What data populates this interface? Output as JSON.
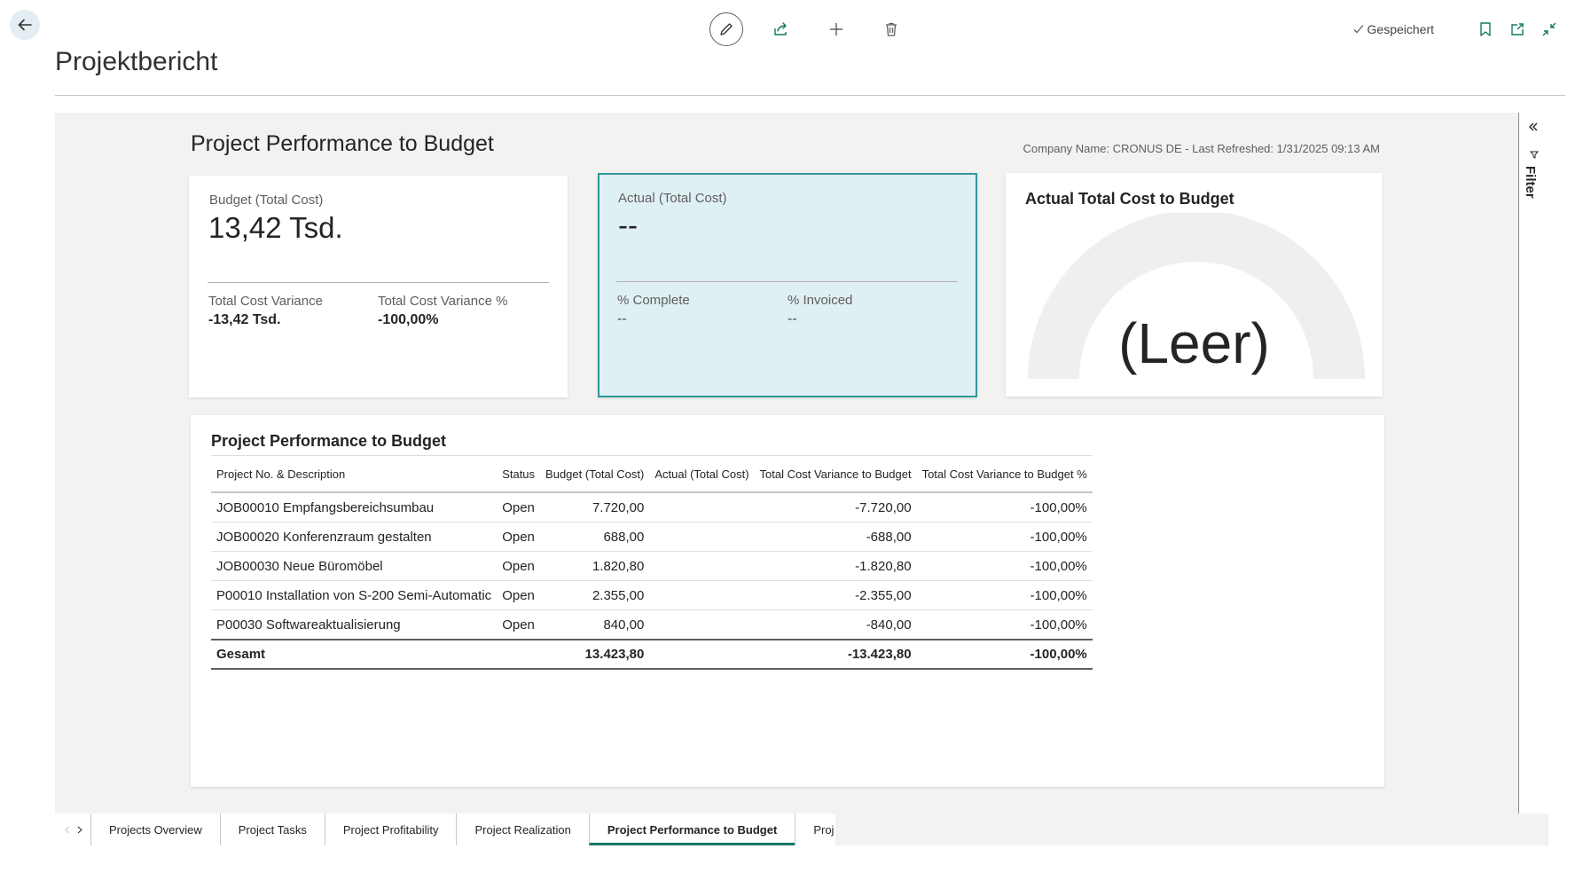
{
  "page": {
    "title": "Projektbericht"
  },
  "toolbar": {
    "status": "Gespeichert",
    "icons": [
      "pencil-icon",
      "share-icon",
      "plus-icon",
      "trash-icon"
    ],
    "right_icons": [
      "bookmark-icon",
      "open-new-window-icon",
      "collapse-icon"
    ]
  },
  "filter_pane": {
    "label": "Filter"
  },
  "report": {
    "title": "Project Performance to Budget",
    "company_line": "Company Name: CRONUS DE - Last Refreshed: 1/31/2025 09:13 AM"
  },
  "card_budget": {
    "label": "Budget (Total Cost)",
    "value": "13,42 Tsd.",
    "sub1_label": "Total Cost Variance",
    "sub1_value": "-13,42 Tsd.",
    "sub2_label": "Total Cost Variance %",
    "sub2_value": "-100,00%"
  },
  "card_actual": {
    "label": "Actual (Total Cost)",
    "value": "--",
    "sub1_label": "% Complete",
    "sub1_value": "--",
    "sub2_label": "% Invoiced",
    "sub2_value": "--"
  },
  "card_gauge": {
    "title": "Actual Total Cost to Budget",
    "value": "(Leer)"
  },
  "table": {
    "title": "Project Performance to Budget",
    "headers": {
      "project": "Project No. & Description",
      "status": "Status",
      "budget": "Budget (Total Cost)",
      "actual": "Actual (Total Cost)",
      "variance": "Total Cost Variance to Budget",
      "variance_pct": "Total Cost Variance to Budget %"
    },
    "rows": [
      {
        "project": "JOB00010 Empfangsbereichsumbau",
        "status": "Open",
        "budget": "7.720,00",
        "actual": "",
        "variance": "-7.720,00",
        "variance_pct": "-100,00%"
      },
      {
        "project": "JOB00020 Konferenzraum gestalten",
        "status": "Open",
        "budget": "688,00",
        "actual": "",
        "variance": "-688,00",
        "variance_pct": "-100,00%"
      },
      {
        "project": "JOB00030 Neue Büromöbel",
        "status": "Open",
        "budget": "1.820,80",
        "actual": "",
        "variance": "-1.820,80",
        "variance_pct": "-100,00%"
      },
      {
        "project": "P00010 Installation von S-200 Semi-Automatic",
        "status": "Open",
        "budget": "2.355,00",
        "actual": "",
        "variance": "-2.355,00",
        "variance_pct": "-100,00%"
      },
      {
        "project": "P00030 Softwareaktualisierung",
        "status": "Open",
        "budget": "840,00",
        "actual": "",
        "variance": "-840,00",
        "variance_pct": "-100,00%"
      }
    ],
    "total": {
      "project": "Gesamt",
      "status": "",
      "budget": "13.423,80",
      "actual": "",
      "variance": "-13.423,80",
      "variance_pct": "-100,00%"
    }
  },
  "tabs": [
    {
      "label": "Projects Overview",
      "active": false
    },
    {
      "label": "Project Tasks",
      "active": false
    },
    {
      "label": "Project Profitability",
      "active": false
    },
    {
      "label": "Project Realization",
      "active": false
    },
    {
      "label": "Project Performance to Budget",
      "active": true
    },
    {
      "label": "Proj",
      "active": false
    }
  ],
  "colors": {
    "accent_teal": "#117865",
    "selected_card_border": "#33999b",
    "selected_card_bg": "#dff0f4"
  }
}
